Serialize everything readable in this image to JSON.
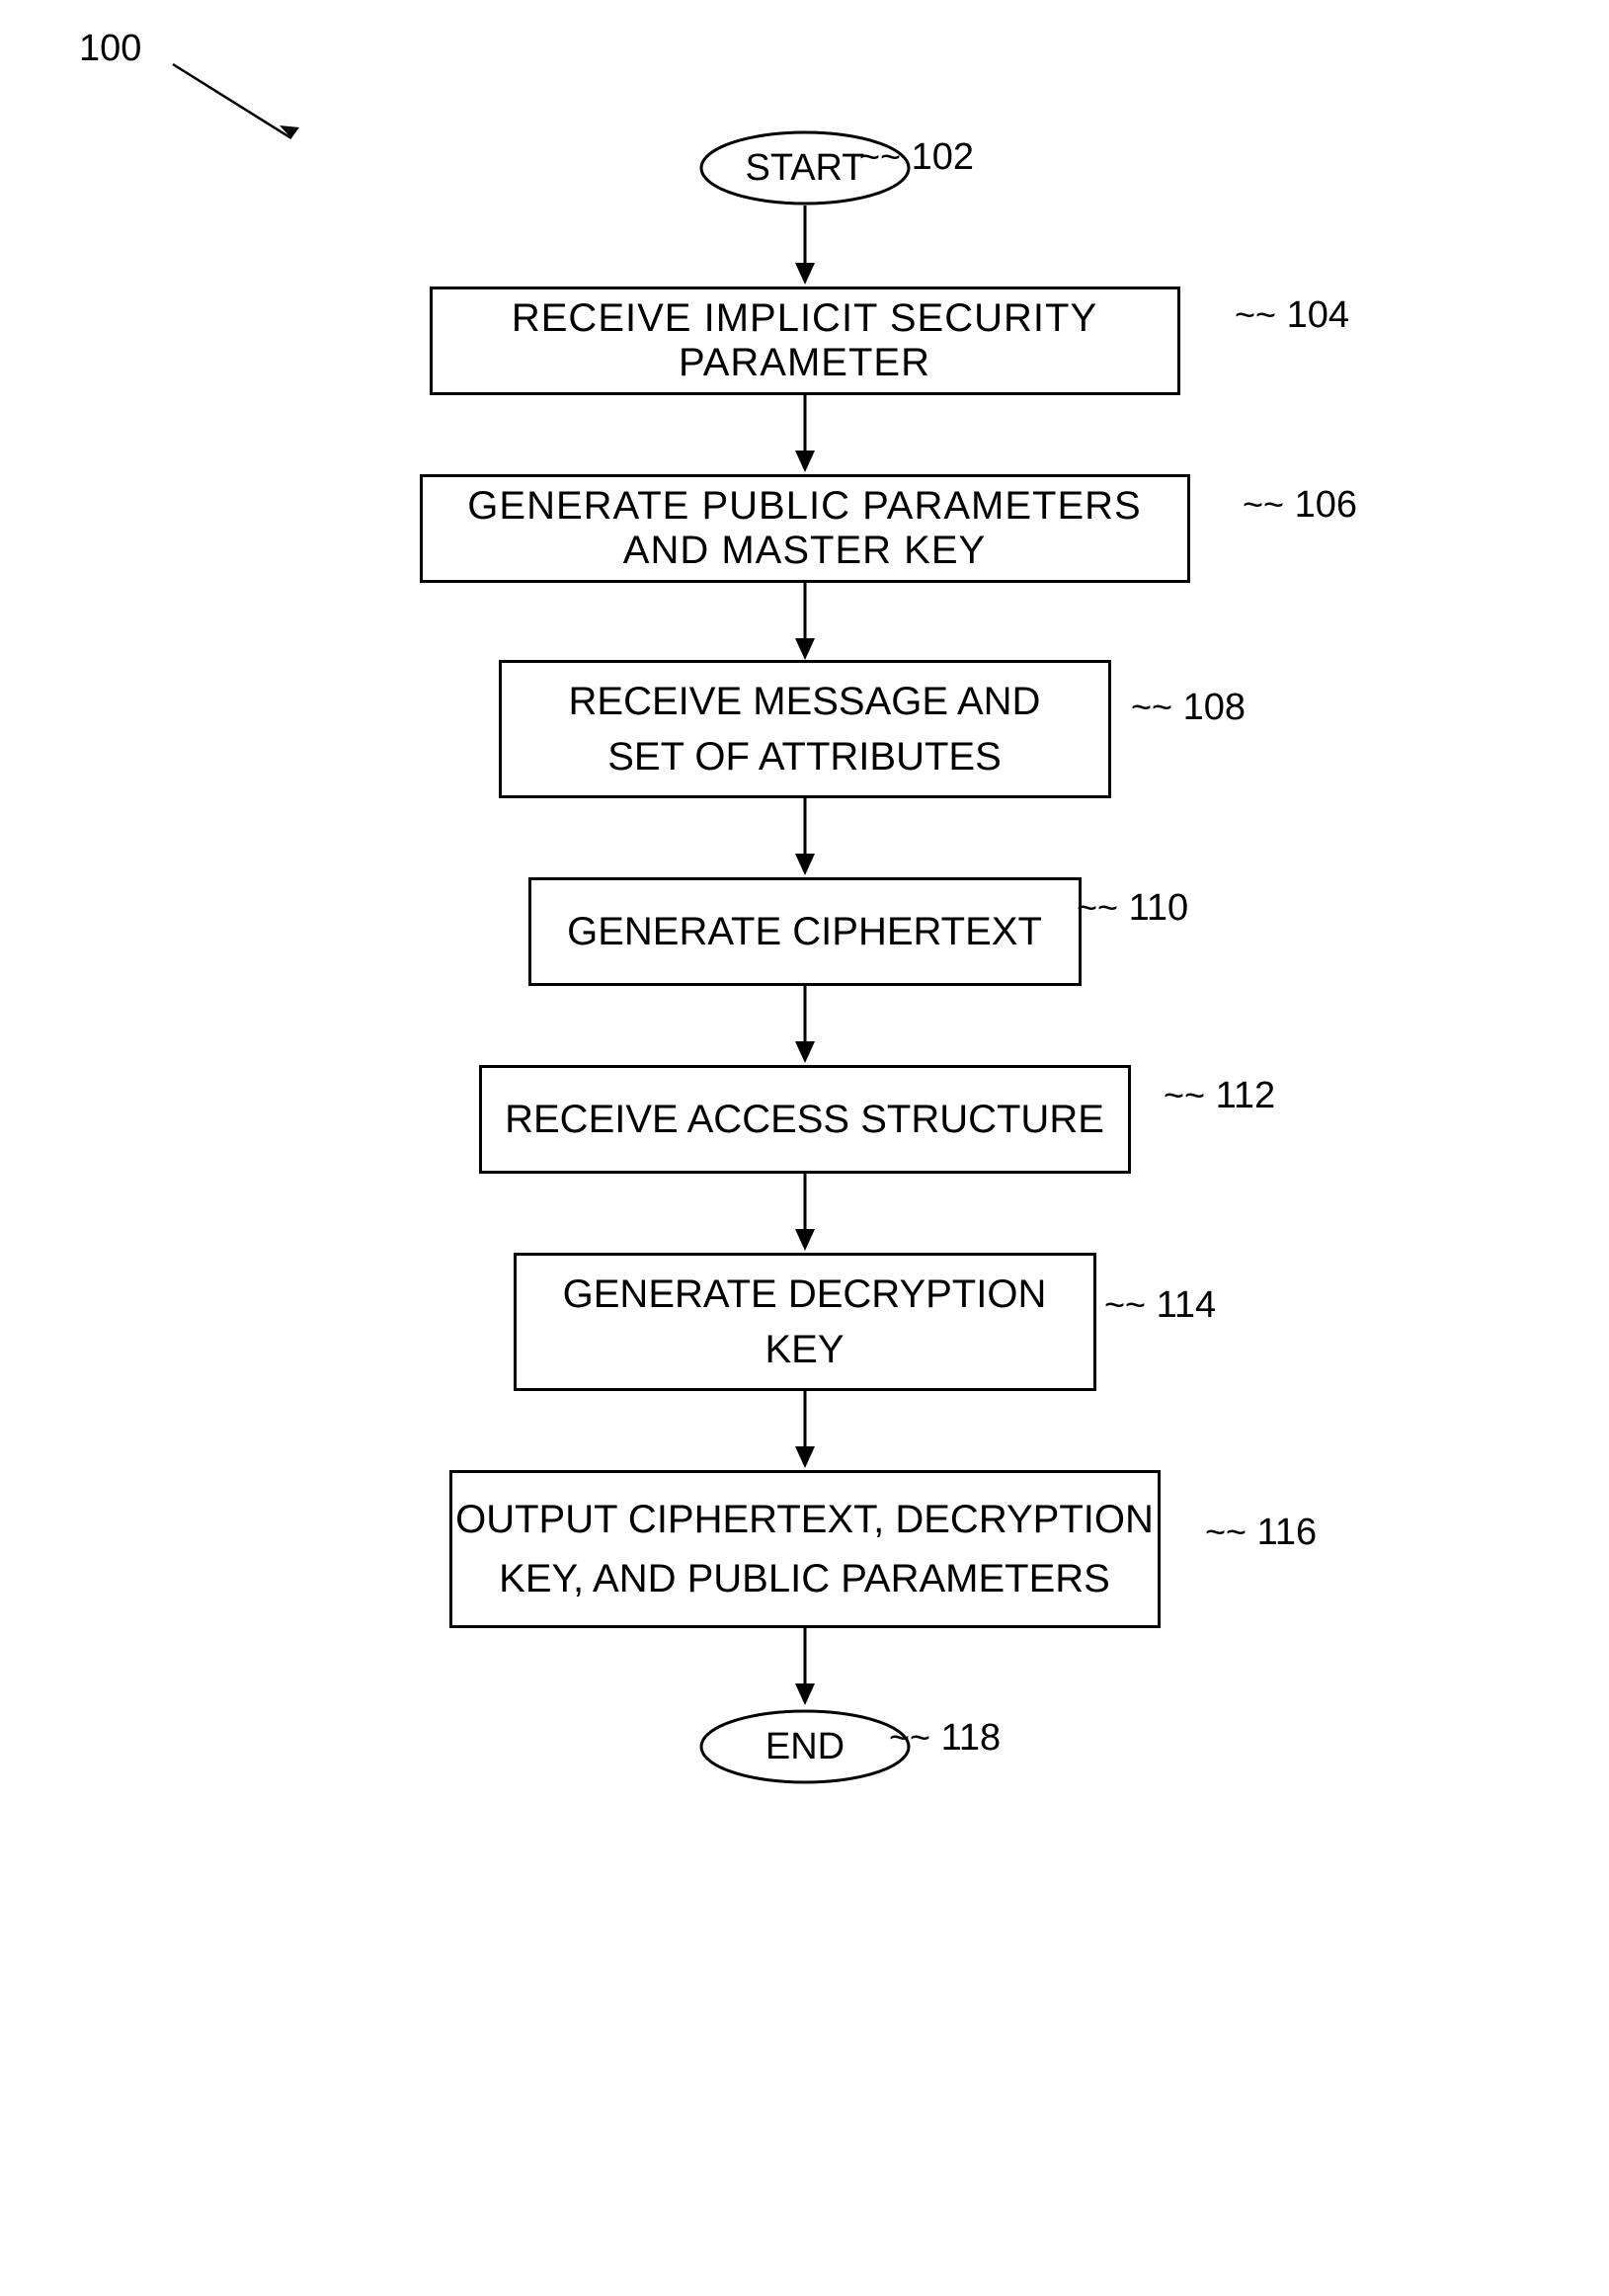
{
  "diagram": {
    "main_label": "100",
    "nodes": {
      "start": {
        "text": "START",
        "ref": "102"
      },
      "box_104": {
        "text": "RECEIVE IMPLICIT SECURITY PARAMETER",
        "ref": "104"
      },
      "box_106": {
        "text": "GENERATE PUBLIC PARAMETERS AND MASTER KEY",
        "ref": "106"
      },
      "box_108": {
        "line1": "RECEIVE MESSAGE AND",
        "line2": "SET OF ATTRIBUTES",
        "ref": "108"
      },
      "box_110": {
        "text": "GENERATE CIPHERTEXT",
        "ref": "110"
      },
      "box_112": {
        "text": "RECEIVE ACCESS STRUCTURE",
        "ref": "112"
      },
      "box_114": {
        "line1": "GENERATE DECRYPTION",
        "line2": "KEY",
        "ref": "114"
      },
      "box_116": {
        "line1": "OUTPUT CIPHERTEXT, DECRYPTION",
        "line2": "KEY, AND PUBLIC PARAMETERS",
        "ref": "116"
      },
      "end": {
        "text": "END",
        "ref": "118"
      }
    }
  }
}
